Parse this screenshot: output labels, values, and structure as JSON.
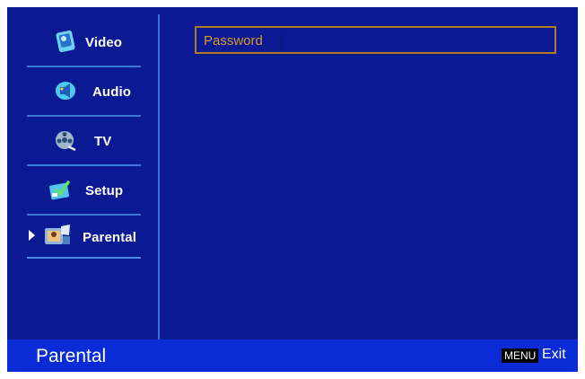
{
  "sidebar": {
    "items": [
      {
        "label": "Video",
        "icon": "video-icon"
      },
      {
        "label": "Audio",
        "icon": "audio-icon"
      },
      {
        "label": "TV",
        "icon": "tv-icon"
      },
      {
        "label": "Setup",
        "icon": "setup-icon"
      },
      {
        "label": "Parental",
        "icon": "parental-icon",
        "selected": true
      }
    ]
  },
  "main": {
    "password_label": "Password",
    "password_value": ""
  },
  "statusbar": {
    "title": "Parental",
    "menu_key": "MENU",
    "exit_label": "Exit"
  },
  "colors": {
    "panel": "#0b1a93",
    "statusbar": "#0b2bd6",
    "accent_rule": "#3b78d8",
    "password_border": "#b07a1e",
    "password_text": "#d89a2b"
  }
}
